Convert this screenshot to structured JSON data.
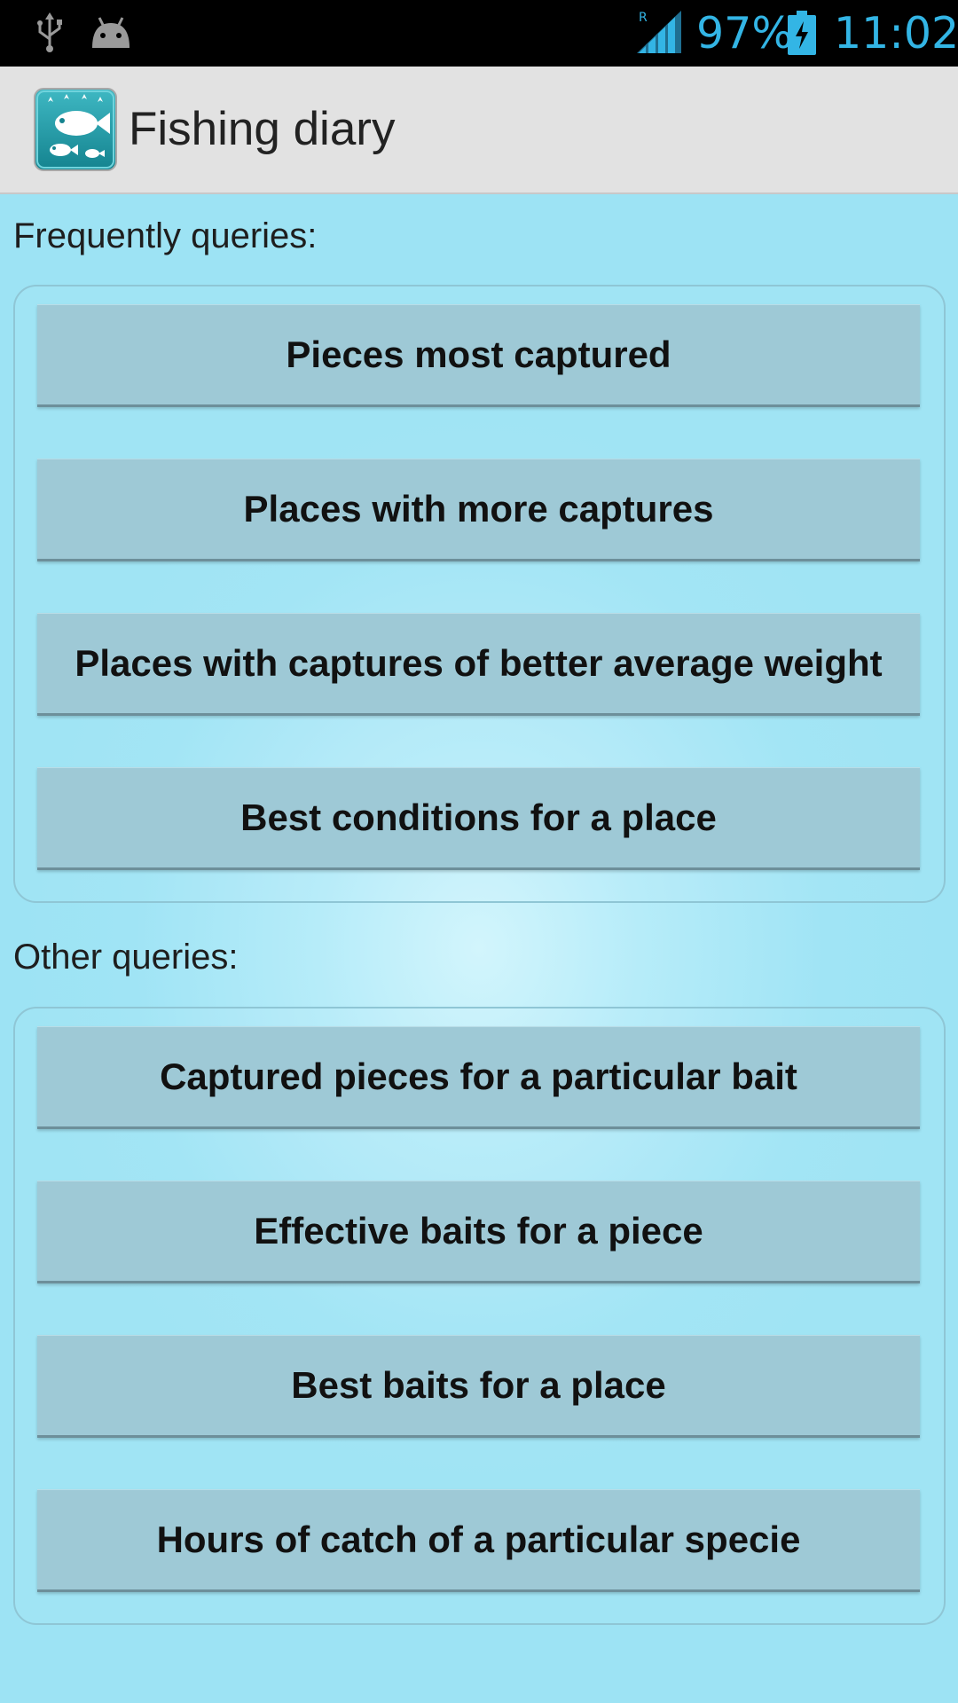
{
  "status_bar": {
    "icons": [
      "usb-icon",
      "android-debug-icon",
      "signal-roaming-icon",
      "battery-charging-icon"
    ],
    "roaming_indicator": "R",
    "battery_percent": "97%",
    "time": "11:02"
  },
  "action_bar": {
    "icon": "fishing-diary-app-icon",
    "title": "Fishing diary"
  },
  "frequent": {
    "label": "Frequently queries:",
    "buttons": [
      "Pieces most captured",
      "Places with more captures",
      "Places with captures of better average weight",
      "Best conditions for a place"
    ]
  },
  "other": {
    "label": "Other queries:",
    "buttons": [
      "Captured pieces for a particular bait",
      "Effective baits for a piece",
      "Best baits for a place",
      "Hours of catch of a particular specie"
    ]
  },
  "colors": {
    "status_accent": "#33b5e5",
    "background": "#9fe4f5",
    "button": "#9ec9d6",
    "action_bar": "#e2e2e2"
  }
}
